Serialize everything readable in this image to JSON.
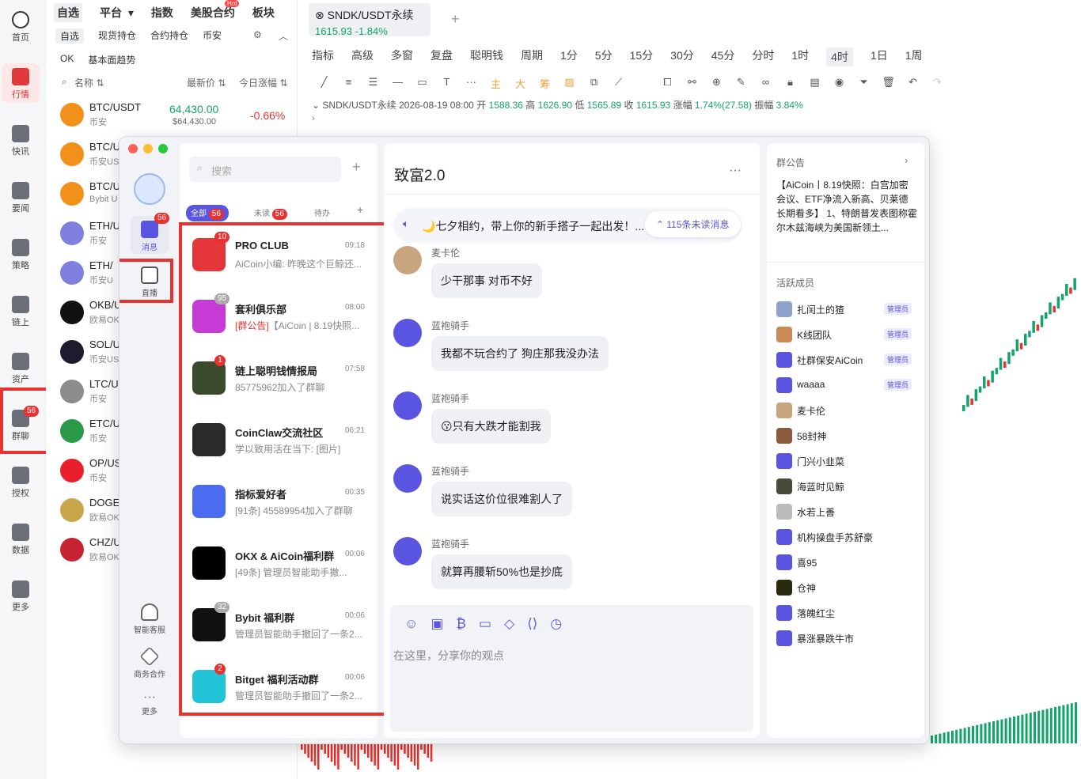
{
  "leftnav": {
    "items": [
      {
        "label": "首页",
        "icon": "home-icon"
      },
      {
        "label": "行情",
        "icon": "market-chart-icon"
      },
      {
        "label": "快讯",
        "icon": "news-flash-icon"
      },
      {
        "label": "要闻",
        "icon": "headline-icon"
      },
      {
        "label": "策略",
        "icon": "strategy-robot-icon"
      },
      {
        "label": "链上",
        "icon": "onchain-icon"
      },
      {
        "label": "资产",
        "icon": "wallet-icon"
      },
      {
        "label": "群聊",
        "icon": "group-chat-icon",
        "badge": "56"
      },
      {
        "label": "授权",
        "icon": "authorize-icon"
      },
      {
        "label": "数据",
        "icon": "data-icon"
      },
      {
        "label": "更多",
        "icon": "more-grid-icon"
      }
    ]
  },
  "market": {
    "tabs": [
      "自选",
      "平台",
      "指数",
      "美股合约",
      "板块"
    ],
    "hot_badge": "Hot",
    "subtabs": [
      "自选",
      "现货持仓",
      "合约持仓",
      "币安"
    ],
    "subtabs2": [
      "OK",
      "基本面趋势"
    ],
    "columns": {
      "name": "名称",
      "price": "最新价",
      "change": "今日涨幅"
    },
    "coins": [
      {
        "symbol": "BTC/USDT",
        "exchange": "币安",
        "price": "64,430.00",
        "price_sub": "$64,430.00",
        "change": "-0.66%",
        "color": "#f2901c"
      },
      {
        "symbol": "BTC/U",
        "exchange": "币安US",
        "color": "#f2901c"
      },
      {
        "symbol": "BTC/U",
        "exchange": "Bybit U",
        "color": "#f2901c"
      },
      {
        "symbol": "ETH/U",
        "exchange": "币安",
        "color": "#7f7fe0"
      },
      {
        "symbol": "ETH/",
        "exchange": "币安U",
        "color": "#7f7fe0"
      },
      {
        "symbol": "OKB/U",
        "exchange": "欧易OK",
        "color": "#111111"
      },
      {
        "symbol": "SOL/U",
        "exchange": "币安US",
        "color": "#1c1c2e"
      },
      {
        "symbol": "LTC/U",
        "exchange": "币安",
        "color": "#8c8c8c"
      },
      {
        "symbol": "ETC/U",
        "exchange": "币安",
        "color": "#2b9a48"
      },
      {
        "symbol": "OP/US",
        "exchange": "币安",
        "color": "#ea1f2c"
      },
      {
        "symbol": "DOGE/",
        "exchange": "欧易OK",
        "color": "#c9a54b"
      },
      {
        "symbol": "CHZ/U",
        "exchange": "欧易OK",
        "color": "#c72332"
      }
    ]
  },
  "chart": {
    "tab_title": "SNDK/USDT永续",
    "tab_price": "1615.93",
    "tab_change": "-1.84%",
    "add_tab": "+",
    "toolbar": [
      "指标",
      "高级",
      "多窗",
      "复盘",
      "聪明钱",
      "周期",
      "1分",
      "5分",
      "15分",
      "30分",
      "45分",
      "分时",
      "1时",
      "4时",
      "1日",
      "1周"
    ],
    "selected_period": "4时",
    "ohlc": {
      "symbol": "SNDK/USDT永续",
      "date": "2026-08-19 08:00",
      "open_label": "开",
      "open": "1588.36",
      "high_label": "高",
      "high": "1626.90",
      "low_label": "低",
      "low": "1565.89",
      "close_label": "收",
      "close": "1615.93",
      "change_label": "涨幅",
      "change": "1.74%(27.58)",
      "amp_label": "振幅",
      "amp": "3.84%"
    },
    "colors": {
      "up": "#13a36c",
      "down": "#e8322f"
    }
  },
  "chat": {
    "side": {
      "messages_label": "消息",
      "messages_badge": "56",
      "live_label": "直播",
      "service_label": "智能客服",
      "biz_label": "商务合作",
      "more_label": "更多"
    },
    "search_placeholder": "搜索",
    "filters": [
      {
        "label": "全部",
        "badge": "56"
      },
      {
        "label": "未读",
        "badge": "56"
      },
      {
        "label": "待办"
      }
    ],
    "conversations": [
      {
        "name": "PRO CLUB",
        "time": "09:18",
        "preview": "AiCoin小编: 昨晚这个巨鲸还...",
        "badge": "10",
        "color": "#e5373a"
      },
      {
        "name": "套利俱乐部",
        "time": "08:00",
        "tag": "[群公告]",
        "preview": "【AiCoin | 8.19快照...",
        "badge": "95",
        "color": "#c63ad6"
      },
      {
        "name": "链上聪明钱情报局",
        "time": "07:58",
        "preview": "85775962加入了群聊",
        "badge": "1",
        "color": "#3b4a2a"
      },
      {
        "name": "CoinClaw交流社区",
        "time": "06:21",
        "preview": "学以致用活在当下: [图片]",
        "color": "#2a2a2a"
      },
      {
        "name": "指标爱好者",
        "time": "00:35",
        "preview": "[91条] 45589954加入了群聊",
        "color": "#4a6cf0"
      },
      {
        "name": "OKX & AiCoin福利群",
        "time": "00:06",
        "preview": "[49条] 管理员智能助手撤...",
        "color": "#000000"
      },
      {
        "name": "Bybit 福利群",
        "time": "00:06",
        "preview": "管理员智能助手撤回了一条2...",
        "badge": "32",
        "color": "#111111"
      },
      {
        "name": "Bitget 福利活动群",
        "time": "00:06",
        "preview": "管理员智能助手撤回了一条2...",
        "badge": "2",
        "color": "#22c4d8"
      }
    ],
    "group": {
      "title": "致富2.0",
      "more": "···",
      "pinned": "🌙七夕相约，带上你的新手搭子一起出发！...",
      "unread": "115条未读消息",
      "messages": [
        {
          "sender": "麦卡伦",
          "text": "少干那事 对币不好"
        },
        {
          "sender": "蓝袍骑手",
          "text": "我都不玩合约了 狗庄那我没办法"
        },
        {
          "sender": "蓝袍骑手",
          "text": "😗只有大跌才能割我"
        },
        {
          "sender": "蓝袍骑手",
          "text": "说实话这价位很难割人了"
        },
        {
          "sender": "蓝袍骑手",
          "text": "就算再腰斩50%也是抄底"
        }
      ],
      "compose_placeholder": "在这里，分享你的观点"
    },
    "notice": {
      "title": "群公告",
      "text": "【AiCoin丨8.19快照：白宫加密会议、ETF净流入新高、贝莱德长期看多】 1、特朗普发表图称霍尔木兹海峡为美国新领土..."
    },
    "members_title": "活跃成员",
    "admin_label": "管理员",
    "members": [
      {
        "name": "扎闰土的猹",
        "admin": true,
        "color": "#8fa1c8"
      },
      {
        "name": "K线团队",
        "admin": true,
        "color": "#c98a55"
      },
      {
        "name": "社群保安AiCoin",
        "admin": true,
        "color": "#5a55e0"
      },
      {
        "name": "waaaa",
        "admin": true,
        "color": "#5a55e0"
      },
      {
        "name": "麦卡伦",
        "admin": false,
        "color": "#c9a57f"
      },
      {
        "name": "58封神",
        "admin": false,
        "color": "#8a5a3a"
      },
      {
        "name": "门兴小韭菜",
        "admin": false,
        "color": "#5a55e0"
      },
      {
        "name": "海蓝时见鲸",
        "admin": false,
        "color": "#4a4a3a"
      },
      {
        "name": "水若上善",
        "admin": false,
        "color": "#bbbbbb"
      },
      {
        "name": "机构操盘手苏舒豪",
        "admin": false,
        "color": "#5a55e0"
      },
      {
        "name": "喜95",
        "admin": false,
        "color": "#5a55e0"
      },
      {
        "name": "仓神",
        "admin": false,
        "color": "#2a2a10"
      },
      {
        "name": "落魄红尘",
        "admin": false,
        "color": "#5a55e0"
      },
      {
        "name": "暴涨暴跌牛市",
        "admin": false,
        "color": "#5a55e0"
      }
    ]
  }
}
